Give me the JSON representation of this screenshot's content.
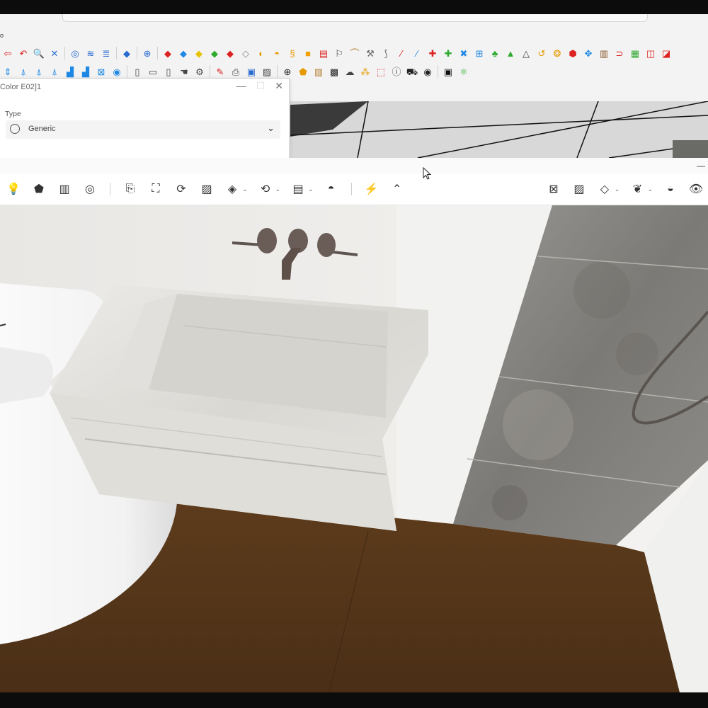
{
  "host": {
    "menu_fragment": "o",
    "toolbar_row1": [
      {
        "icon": "arrow-left-icon",
        "glyph": "⇦",
        "color": "#d22"
      },
      {
        "icon": "undo-icon",
        "glyph": "↶",
        "color": "#d22"
      },
      {
        "icon": "zoom-icon",
        "glyph": "🔍",
        "color": "#2a6bd1"
      },
      {
        "icon": "zoom-extents-icon",
        "glyph": "✕",
        "color": "#2a6bd1"
      },
      {
        "icon": "sep"
      },
      {
        "icon": "globe-icon",
        "glyph": "◎",
        "color": "#2a6bd1"
      },
      {
        "icon": "layers-icon",
        "glyph": "≋",
        "color": "#2a6bd1"
      },
      {
        "icon": "stack-icon",
        "glyph": "≣",
        "color": "#2a6bd1"
      },
      {
        "icon": "sep"
      },
      {
        "icon": "component-icon",
        "glyph": "◆",
        "color": "#2a6bd1"
      },
      {
        "icon": "sep"
      },
      {
        "icon": "search-globe-icon",
        "glyph": "⊕",
        "color": "#2a6bd1"
      },
      {
        "icon": "sep"
      },
      {
        "icon": "red-cube-icon",
        "glyph": "◆",
        "color": "#d22"
      },
      {
        "icon": "blue-diamond-icon",
        "glyph": "◆",
        "color": "#1e88e5"
      },
      {
        "icon": "yellow-diamond-icon",
        "glyph": "◆",
        "color": "#e6c200"
      },
      {
        "icon": "green-diamond-icon",
        "glyph": "◆",
        "color": "#2eaa2e"
      },
      {
        "icon": "red-diamond-icon",
        "glyph": "◆",
        "color": "#d22"
      },
      {
        "icon": "white-diamond-icon",
        "glyph": "◇",
        "color": "#888"
      },
      {
        "icon": "orange-ring-icon",
        "glyph": "◐",
        "color": "#e69a00"
      },
      {
        "icon": "orange-arc-icon",
        "glyph": "◓",
        "color": "#e69a00"
      },
      {
        "icon": "spiral-icon",
        "glyph": "§",
        "color": "#e69a00"
      },
      {
        "icon": "orange-square-icon",
        "glyph": "■",
        "color": "#f0a000"
      },
      {
        "icon": "table-icon",
        "glyph": "▤",
        "color": "#d22"
      },
      {
        "icon": "flag-icon",
        "glyph": "⚐",
        "color": "#444"
      },
      {
        "icon": "bridge-icon",
        "glyph": "⌒",
        "color": "#b4782a"
      },
      {
        "icon": "wrench-icon",
        "glyph": "⚒",
        "color": "#666"
      },
      {
        "icon": "curve-icon",
        "glyph": "⟆",
        "color": "#666"
      },
      {
        "icon": "red-path-icon",
        "glyph": "⁄",
        "color": "#d22"
      },
      {
        "icon": "blue-path-icon",
        "glyph": "⁄",
        "color": "#1e88e5"
      },
      {
        "icon": "red-cross-icon",
        "glyph": "✚",
        "color": "#d22"
      },
      {
        "icon": "green-cross-icon",
        "glyph": "✚",
        "color": "#2eaa2e"
      },
      {
        "icon": "blue-x-icon",
        "glyph": "✖",
        "color": "#1e88e5"
      },
      {
        "icon": "grid-icon",
        "glyph": "⊞",
        "color": "#1e88e5"
      },
      {
        "icon": "lamp-icon",
        "glyph": "♣",
        "color": "#2eaa2e"
      },
      {
        "icon": "pyramid-icon",
        "glyph": "▲",
        "color": "#2eaa2e"
      },
      {
        "icon": "warning-icon",
        "glyph": "△",
        "color": "#444"
      },
      {
        "icon": "bend-icon",
        "glyph": "↺",
        "color": "#e69a00"
      },
      {
        "icon": "swirl-icon",
        "glyph": "❂",
        "color": "#e69a00"
      },
      {
        "icon": "pin-icon",
        "glyph": "⬢",
        "color": "#d22"
      },
      {
        "icon": "move-icon",
        "glyph": "✥",
        "color": "#1e88e5"
      },
      {
        "icon": "box-icon",
        "glyph": "▥",
        "color": "#8a5a2a"
      },
      {
        "icon": "magnet-icon",
        "glyph": "⊃",
        "color": "#d22"
      },
      {
        "icon": "blocks-icon",
        "glyph": "▦",
        "color": "#2eaa2e"
      },
      {
        "icon": "cubes-icon",
        "glyph": "◫",
        "color": "#d22"
      },
      {
        "icon": "cube-red-icon",
        "glyph": "◪",
        "color": "#d22"
      }
    ],
    "toolbar_row2": [
      {
        "icon": "scale-icon",
        "glyph": "⇕",
        "color": "#1e88e5"
      },
      {
        "icon": "pin-down-icon",
        "glyph": "⍋",
        "color": "#1e88e5"
      },
      {
        "icon": "pin-blue-icon",
        "glyph": "⍋",
        "color": "#1e88e5"
      },
      {
        "icon": "pin-left-icon",
        "glyph": "⍋",
        "color": "#1e88e5"
      },
      {
        "icon": "stairs-icon",
        "glyph": "▟",
        "color": "#1e88e5"
      },
      {
        "icon": "stairs-up-icon",
        "glyph": "▟",
        "color": "#1e88e5"
      },
      {
        "icon": "x-grid-icon",
        "glyph": "⊠",
        "color": "#1e88e5"
      },
      {
        "icon": "eye-icon",
        "glyph": "◉",
        "color": "#1e88e5"
      },
      {
        "icon": "sep"
      },
      {
        "icon": "door-icon",
        "glyph": "▯",
        "color": "#444"
      },
      {
        "icon": "window-icon",
        "glyph": "▭",
        "color": "#444"
      },
      {
        "icon": "panel-icon",
        "glyph": "▯",
        "color": "#444"
      },
      {
        "icon": "hand-icon",
        "glyph": "☚",
        "color": "#444"
      },
      {
        "icon": "gear-icon",
        "glyph": "⚙",
        "color": "#444"
      },
      {
        "icon": "sep"
      },
      {
        "icon": "brush-icon",
        "glyph": "✎",
        "color": "#d22"
      },
      {
        "icon": "printer-icon",
        "glyph": "⎙",
        "color": "#444"
      },
      {
        "icon": "selected-tool-icon",
        "glyph": "▣",
        "color": "#2a6bd1"
      },
      {
        "icon": "paste-icon",
        "glyph": "▨",
        "color": "#444"
      },
      {
        "icon": "sep"
      },
      {
        "icon": "plus-circle-icon",
        "glyph": "⊕",
        "color": "#222"
      },
      {
        "icon": "shield-icon",
        "glyph": "⬟",
        "color": "#e69a00"
      },
      {
        "icon": "books-icon",
        "glyph": "▥",
        "color": "#b4782a"
      },
      {
        "icon": "checker-icon",
        "glyph": "▩",
        "color": "#222"
      },
      {
        "icon": "cloud-icon",
        "glyph": "☁",
        "color": "#444"
      },
      {
        "icon": "settings-dots-icon",
        "glyph": "⁂",
        "color": "#e69a00"
      },
      {
        "icon": "export-icon",
        "glyph": "⬚",
        "color": "#d22"
      },
      {
        "icon": "info-icon",
        "glyph": "ⓘ",
        "color": "#444"
      },
      {
        "icon": "cart-icon",
        "glyph": "⛟",
        "color": "#222"
      },
      {
        "icon": "account-icon",
        "glyph": "◉",
        "color": "#222"
      },
      {
        "icon": "sep"
      },
      {
        "icon": "app-logo-icon",
        "glyph": "▣",
        "color": "#111"
      },
      {
        "icon": "molecule-icon",
        "glyph": "⚛",
        "color": "#2eaa2e"
      }
    ]
  },
  "dialog": {
    "title": "Color E02]1",
    "type_label": "Type",
    "type_value": "Generic"
  },
  "render": {
    "toolbar": [
      {
        "icon": "bulb-icon",
        "glyph": "💡",
        "drop": false
      },
      {
        "icon": "shield-light-icon",
        "glyph": "⬟",
        "drop": false
      },
      {
        "icon": "library-icon",
        "glyph": "▥",
        "drop": false
      },
      {
        "icon": "material-icon",
        "glyph": "◎",
        "drop": false
      },
      {
        "icon": "sep"
      },
      {
        "icon": "document-cursor-icon",
        "glyph": "⎘",
        "drop": false
      },
      {
        "icon": "capture-icon",
        "glyph": "⛶",
        "drop": false
      },
      {
        "icon": "panorama-icon",
        "glyph": "⟳",
        "drop": false
      },
      {
        "icon": "image-icon",
        "glyph": "▨",
        "drop": false
      },
      {
        "icon": "video-icon",
        "glyph": "◈",
        "drop": true
      },
      {
        "icon": "view-360-icon",
        "glyph": "⟲",
        "drop": true
      },
      {
        "icon": "export-exe-icon",
        "glyph": "▤",
        "drop": true
      },
      {
        "icon": "vr-icon",
        "glyph": "◓",
        "drop": false
      },
      {
        "icon": "sep"
      },
      {
        "icon": "bolt-icon",
        "glyph": "⚡",
        "drop": false
      },
      {
        "icon": "chevron-up-icon",
        "glyph": "⌃",
        "drop": false
      }
    ],
    "toolbar_right": [
      {
        "icon": "map-icon",
        "glyph": "⊠",
        "drop": false
      },
      {
        "icon": "picture-icon",
        "glyph": "▨",
        "drop": false
      },
      {
        "icon": "cube-icon",
        "glyph": "◇",
        "drop": true
      },
      {
        "icon": "leaf-icon",
        "glyph": "❦",
        "drop": true
      },
      {
        "icon": "person-icon",
        "glyph": "◒",
        "drop": false
      },
      {
        "icon": "eye-icon",
        "glyph": "👁",
        "drop": false
      }
    ]
  },
  "colors": {
    "floor": "#5a3a1c",
    "wall": "#f0f0ee",
    "stone": "#8a8a88",
    "marble": "#e6e4e0"
  }
}
